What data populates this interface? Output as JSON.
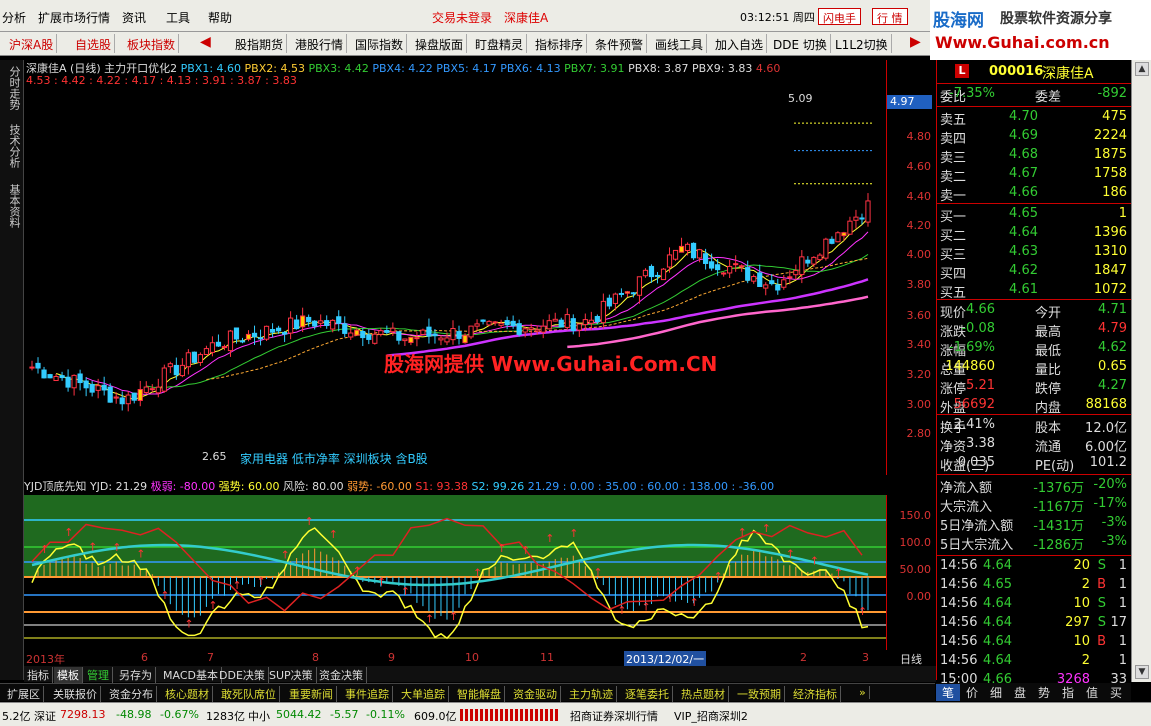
{
  "menubar": {
    "items": [
      "分析",
      "扩展市场行情",
      "资讯",
      "工具",
      "帮助"
    ],
    "login_status": "交易未登录",
    "stock_name": "深康佳A",
    "time": "03:12:51",
    "weekday": "周四",
    "btn_flash": "闪电手",
    "btn_quote": "行 情"
  },
  "logo": {
    "big": "股海网",
    "mid": "股票软件资源分享",
    "url": "Www.Guhai.com.cn"
  },
  "toolbar": {
    "tabs": [
      "沪深A股",
      "自选股",
      "板块指数",
      "股指期货",
      "港股行情",
      "国际指数",
      "操盘版面",
      "盯盘精灵",
      "指标排序",
      "条件预警",
      "画线工具",
      "加入自选",
      "DDE 切换",
      "L1L2切换"
    ]
  },
  "sidetabs": [
    "分时走势",
    "技术分析",
    "基本资料"
  ],
  "chart": {
    "title_name": "深康佳A (日线)",
    "title_ind": "主力开口优化2",
    "pbx": [
      "PBX1: 4.60",
      "PBX2: 4.53",
      "PBX3: 4.42",
      "PBX4: 4.22",
      "PBX5: 4.17",
      "PBX6: 4.13",
      "PBX7: 3.91",
      "PBX8: 3.87",
      "PBX9: 3.83",
      "4.60"
    ],
    "line2": "4.53 : 4.42 : 4.22 : 4.17 : 4.13 : 3.91 : 3.87 : 3.83",
    "price_ticks": [
      "4.80",
      "4.60",
      "4.40",
      "4.20",
      "4.00",
      "3.80",
      "3.60",
      "3.40",
      "3.20",
      "3.00",
      "2.80"
    ],
    "current_price": "4.97",
    "high_label": "5.09",
    "low_label": "2.65",
    "annotation": "家用电器 低市净率 深圳板块 含B股",
    "watermark": "股海网提供 Www.Guhai.Com.CN"
  },
  "chart_data": {
    "type": "line",
    "title": "深康佳A (日线)",
    "xlabel": "",
    "ylabel": "",
    "ylim": [
      2.6,
      5.2
    ],
    "categories": [
      "2013年",
      "6",
      "7",
      "8",
      "9",
      "10",
      "11",
      "2013/12/02/一",
      "2",
      "3"
    ],
    "series": [
      {
        "name": "close",
        "values": [
          3.28,
          3.05,
          3.45,
          3.6,
          3.48,
          3.55,
          3.6,
          4.1,
          3.85,
          4.4
        ]
      }
    ]
  },
  "indicator": {
    "name": "YJD顶底先知",
    "yjd": "YJD: 21.29",
    "jiruo": "极弱: -80.00",
    "qiangshi": "强势: 60.00",
    "fengxian": "风险: 80.00",
    "ruoshi": "弱势: -60.00",
    "s1": "S1: 93.38",
    "s2": "S2: 99.26",
    "tail": "21.29 : 0.00 : 35.00 : 60.00 : 138.00 : -36.00",
    "ticks": [
      "150.0",
      "100.0",
      "50.00",
      "0.00"
    ]
  },
  "xaxis": {
    "labels": [
      "2013年",
      "6",
      "7",
      "8",
      "9",
      "10",
      "11",
      "2013/12/02/一",
      "2",
      "3"
    ],
    "period": "日线"
  },
  "bottom_tabs": [
    "指标",
    "模板",
    "管理",
    "另存为",
    "MACD基本",
    "DDE决策",
    "SUP决策",
    "资金决策"
  ],
  "func_bar": [
    "扩展区",
    "关联报价",
    "资金分布",
    "核心题材",
    "敢死队席位",
    "重要新闻",
    "事件追踪",
    "大单追踪",
    "智能解盘",
    "资金驱动",
    "主力轨迹",
    "逐笔委托",
    "热点题材",
    "一致预期",
    "经济指标",
    "»"
  ],
  "status": {
    "sh": "5.2亿",
    "sz_label": "深证",
    "sz_val": "7298.13",
    "sz_chg": "-48.98",
    "sz_pct": "-0.67%",
    "sz_amt": "1283亿",
    "zx_label": "中小",
    "zx_val": "5044.42",
    "zx_chg": "-5.57",
    "zx_pct": "-0.11%",
    "zx_amt": "609.0亿",
    "broker": "招商证券深圳行情",
    "vip": "VIP_招商深圳2"
  },
  "quote": {
    "code": "000016",
    "name": "深康佳A",
    "weibi_label": "委比",
    "weibi": "-7.35%",
    "weicha_label": "委差",
    "weicha": "-892",
    "asks": [
      {
        "label": "卖五",
        "price": "4.70",
        "vol": "475"
      },
      {
        "label": "卖四",
        "price": "4.69",
        "vol": "2224"
      },
      {
        "label": "卖三",
        "price": "4.68",
        "vol": "1875"
      },
      {
        "label": "卖二",
        "price": "4.67",
        "vol": "1758"
      },
      {
        "label": "卖一",
        "price": "4.66",
        "vol": "186"
      }
    ],
    "bids": [
      {
        "label": "买一",
        "price": "4.65",
        "vol": "1"
      },
      {
        "label": "买二",
        "price": "4.64",
        "vol": "1396"
      },
      {
        "label": "买三",
        "price": "4.63",
        "vol": "1310"
      },
      {
        "label": "买四",
        "price": "4.62",
        "vol": "1847"
      },
      {
        "label": "买五",
        "price": "4.61",
        "vol": "1072"
      }
    ],
    "stats": [
      {
        "l1": "现价",
        "v1": "4.66",
        "l2": "今开",
        "v2": "4.71"
      },
      {
        "l1": "涨跌",
        "v1": "-0.08",
        "l2": "最高",
        "v2": "4.79"
      },
      {
        "l1": "涨幅",
        "v1": "-1.69%",
        "l2": "最低",
        "v2": "4.62"
      },
      {
        "l1": "总量",
        "v1": "144860",
        "l2": "量比",
        "v2": "0.65"
      },
      {
        "l1": "涨停",
        "v1": "5.21",
        "l2": "跌停",
        "v2": "4.27"
      },
      {
        "l1": "外盘",
        "v1": "56692",
        "l2": "内盘",
        "v2": "88168"
      }
    ],
    "fund": [
      {
        "l1": "换手",
        "v1": "2.41%",
        "l2": "股本",
        "v2": "12.0亿"
      },
      {
        "l1": "净资",
        "v1": "3.38",
        "l2": "流通",
        "v2": "6.00亿"
      },
      {
        "l1": "收益(三)",
        "v1": "0.035",
        "l2": "PE(动)",
        "v2": "101.2"
      }
    ],
    "flows": [
      {
        "label": "净流入额",
        "val": "-1376万",
        "pct": "-20%"
      },
      {
        "label": "大宗流入",
        "val": "-1167万",
        "pct": "-17%"
      },
      {
        "label": "5日净流入额",
        "val": "-1431万",
        "pct": "-3%"
      },
      {
        "label": "5日大宗流入",
        "val": "-1286万",
        "pct": "-3%"
      }
    ],
    "ticks": [
      {
        "time": "14:56",
        "price": "4.64",
        "vol": "20",
        "side": "S",
        "n": "1"
      },
      {
        "time": "14:56",
        "price": "4.65",
        "vol": "2",
        "side": "B",
        "n": "1"
      },
      {
        "time": "14:56",
        "price": "4.64",
        "vol": "10",
        "side": "S",
        "n": "1"
      },
      {
        "time": "14:56",
        "price": "4.64",
        "vol": "297",
        "side": "S",
        "n": "17"
      },
      {
        "time": "14:56",
        "price": "4.64",
        "vol": "10",
        "side": "B",
        "n": "1"
      },
      {
        "time": "14:56",
        "price": "4.64",
        "vol": "2",
        "side": "",
        "n": "1"
      },
      {
        "time": "15:00",
        "price": "4.66",
        "vol": "3268",
        "side": "",
        "n": "33"
      }
    ]
  },
  "right_tabs": [
    "笔",
    "价",
    "细",
    "盘",
    "势",
    "指",
    "值",
    "买"
  ]
}
